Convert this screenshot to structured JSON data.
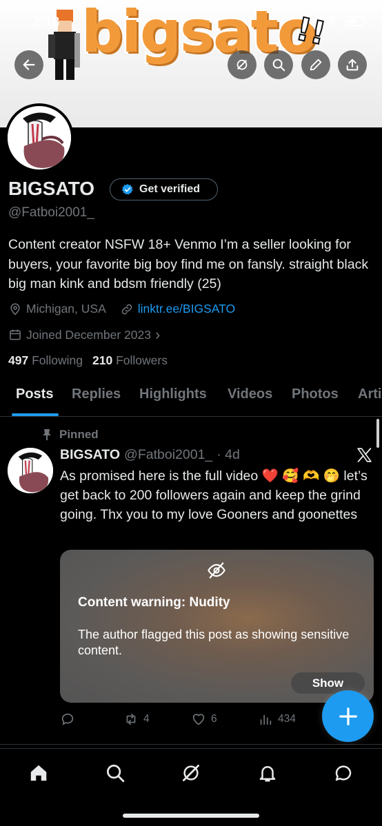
{
  "status_bar": {
    "time": "2:18"
  },
  "banner": {
    "logo_text": "bigsato",
    "exclaim": "!!"
  },
  "profile": {
    "display_name": "BIGSATO",
    "verify_label": "Get verified",
    "handle": "@Fatboi2001_",
    "bio": "Content creator NSFW 18+ Venmo I’m a seller looking for buyers, your favorite big boy find me on fansly. straight black big man kink and bdsm friendly (25)",
    "location": "Michigan, USA",
    "link": "linktr.ee/BIGSATO",
    "joined": "Joined December 2023",
    "joined_chevron": "›",
    "following_count": "497",
    "following_label": "Following",
    "followers_count": "210",
    "followers_label": "Followers"
  },
  "tabs": [
    "Posts",
    "Replies",
    "Highlights",
    "Videos",
    "Photos",
    "Arti"
  ],
  "post": {
    "pinned_label": "Pinned",
    "name": "BIGSATO",
    "handle": "@Fatboi2001_",
    "time": "· 4d",
    "text": "As promised here is the full video ❤️ 🥰 🫶 🤭 let’s get back to 200 followers again and keep the grind going. Thx you to my love Gooners and goonettes",
    "warning_title": "Content warning: Nudity",
    "warning_text": "The author flagged this post as showing sensitive content.",
    "show_label": "Show",
    "reposts": "4",
    "likes": "6",
    "views": "434"
  },
  "colors": {
    "accent": "#1d9bf0",
    "background": "#000000",
    "muted": "#71767b",
    "banner_logo": "#f29a3a"
  },
  "icons": {
    "top_bar": [
      "back-arrow-icon",
      "grok-icon",
      "search-icon",
      "edit-icon",
      "share-icon"
    ],
    "bottom_nav": [
      "home-icon",
      "search-icon",
      "grok-icon",
      "bell-icon",
      "messages-icon"
    ]
  }
}
